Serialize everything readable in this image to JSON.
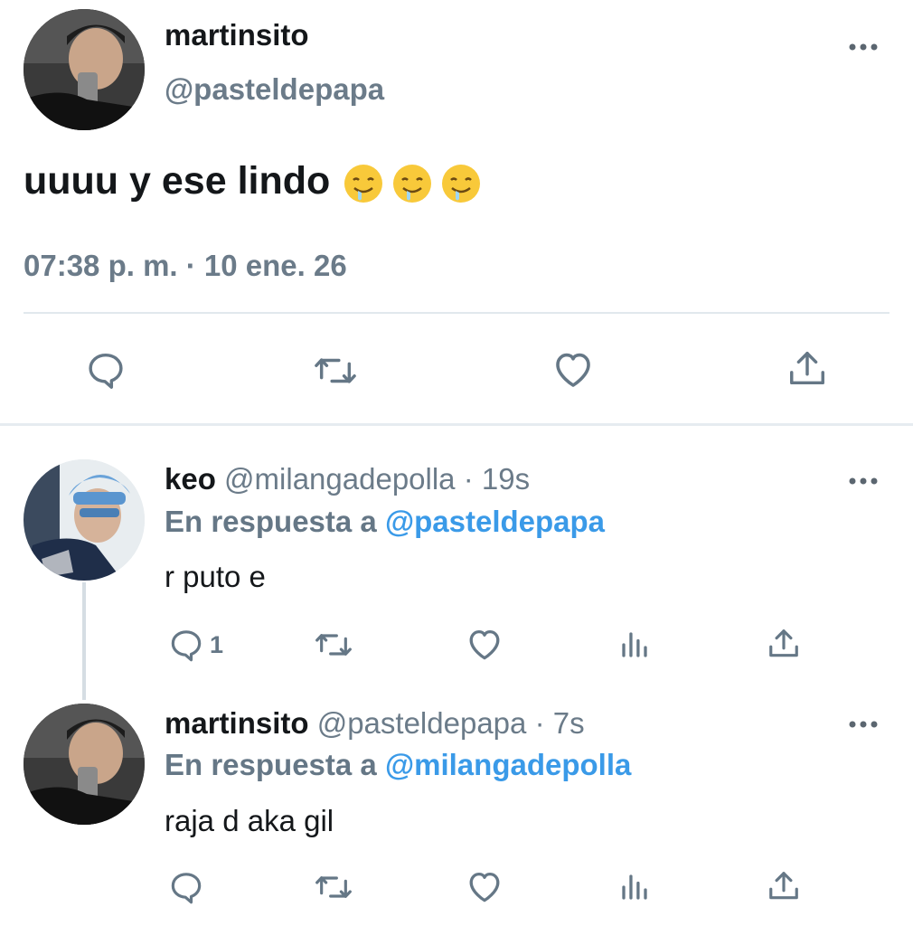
{
  "main_tweet": {
    "display_name": "martinsito",
    "handle": "@pasteldepapa",
    "text": "uuuu y ese lindo",
    "emojis": [
      "drooling-face",
      "drooling-face",
      "drooling-face"
    ],
    "timestamp": "07:38 p. m. · 10 ene. 26",
    "more_label": "more-options",
    "actions": [
      "reply",
      "retweet",
      "like",
      "share"
    ]
  },
  "replies": [
    {
      "display_name": "keo",
      "handle": "@milangadepolla",
      "time": "· 19s",
      "reply_prefix": "En respuesta a",
      "reply_to": "@pasteldepapa",
      "text": "r puto e",
      "reply_count": "1"
    },
    {
      "display_name": "martinsito",
      "handle": "@pasteldepapa",
      "time": "· 7s",
      "reply_prefix": "En respuesta a",
      "reply_to": "@milangadepolla",
      "text": "raja d aka gil",
      "reply_count": ""
    }
  ],
  "colors": {
    "link": "#3a9ae8",
    "muted": "#657786",
    "text": "#14171a",
    "divider": "#e1e8ed"
  }
}
